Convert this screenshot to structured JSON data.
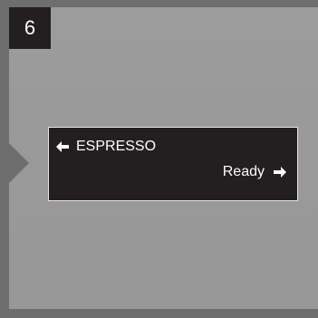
{
  "step": {
    "number": "6"
  },
  "display": {
    "line1": "ESPRESSO",
    "line2": "Ready"
  },
  "colors": {
    "background": "#6e6e6e",
    "panel": "#9a9a9a",
    "badge": "#231f20",
    "display": "#231f20",
    "text": "#ffffff"
  },
  "icons": [
    "arrow-left-icon",
    "arrow-right-icon"
  ]
}
